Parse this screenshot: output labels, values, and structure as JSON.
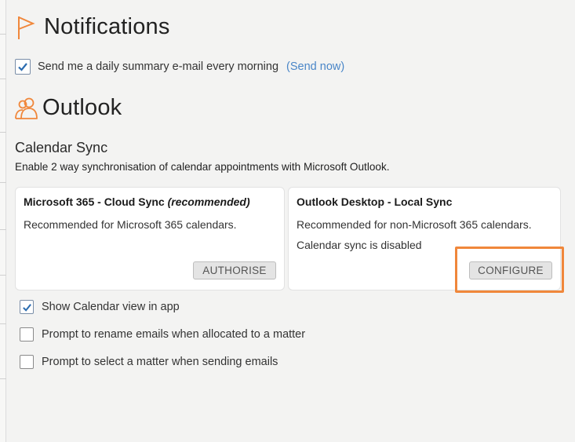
{
  "notifications": {
    "title": "Notifications",
    "daily_summary_label": "Send me a daily summary e-mail every morning",
    "daily_summary_checked": true,
    "send_now_link": "(Send now)"
  },
  "outlook": {
    "title": "Outlook",
    "calendar_sync_title": "Calendar Sync",
    "calendar_sync_desc": "Enable 2 way synchronisation of calendar appointments with Microsoft Outlook.",
    "cloud_card": {
      "title": "Microsoft 365 - Cloud Sync",
      "title_suffix": "(recommended)",
      "desc": "Recommended for Microsoft 365 calendars.",
      "button": "AUTHORISE"
    },
    "local_card": {
      "title": "Outlook Desktop - Local Sync",
      "desc": "Recommended for non-Microsoft 365 calendars.",
      "status": "Calendar sync is disabled",
      "button": "CONFIGURE"
    },
    "options": [
      {
        "label": "Show Calendar view in app",
        "checked": true
      },
      {
        "label": "Prompt to rename emails when allocated to a matter",
        "checked": false
      },
      {
        "label": "Prompt to select a matter when sending emails",
        "checked": false
      }
    ]
  },
  "colors": {
    "accent_orange": "#f0873b",
    "checkbox_blue": "#2b6cb0",
    "link_blue": "#4a86c8"
  },
  "icons": {
    "notifications": "flag-icon",
    "outlook": "users-icon",
    "check": "checkmark-icon"
  }
}
